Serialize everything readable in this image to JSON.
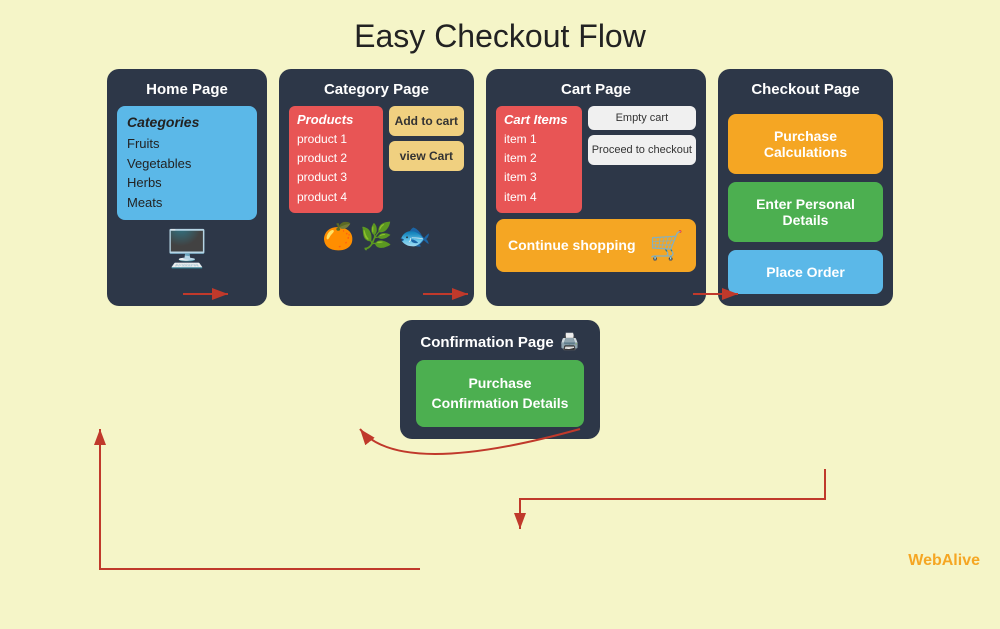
{
  "title": "Easy Checkout Flow",
  "home_page": {
    "card_title": "Home Page",
    "categories_title": "Categories",
    "categories": [
      "Fruits",
      "Vegetables",
      "Herbs",
      "Meats"
    ]
  },
  "category_page": {
    "card_title": "Category Page",
    "products_title": "Products",
    "products": [
      "product 1",
      "product 2",
      "product 3",
      "product 4"
    ],
    "btn_add_cart": "Add to cart",
    "btn_view_cart": "view Cart",
    "emojis": [
      "🍊",
      "🌿",
      "🐟"
    ]
  },
  "cart_page": {
    "card_title": "Cart Page",
    "cart_items_title": "Cart Items",
    "items": [
      "item 1",
      "item 2",
      "item 3",
      "item 4"
    ],
    "btn_empty": "Empty cart",
    "btn_proceed": "Proceed to checkout",
    "btn_continue": "Continue shopping"
  },
  "checkout_page": {
    "card_title": "Checkout Page",
    "btn_purchase_calc": "Purchase Calculations",
    "btn_personal": "Enter Personal Details",
    "btn_place_order": "Place Order"
  },
  "confirmation_page": {
    "card_title": "Confirmation Page",
    "btn_details": "Purchase Confirmation Details"
  },
  "brand": {
    "web": "Web",
    "alive": "Alive"
  }
}
